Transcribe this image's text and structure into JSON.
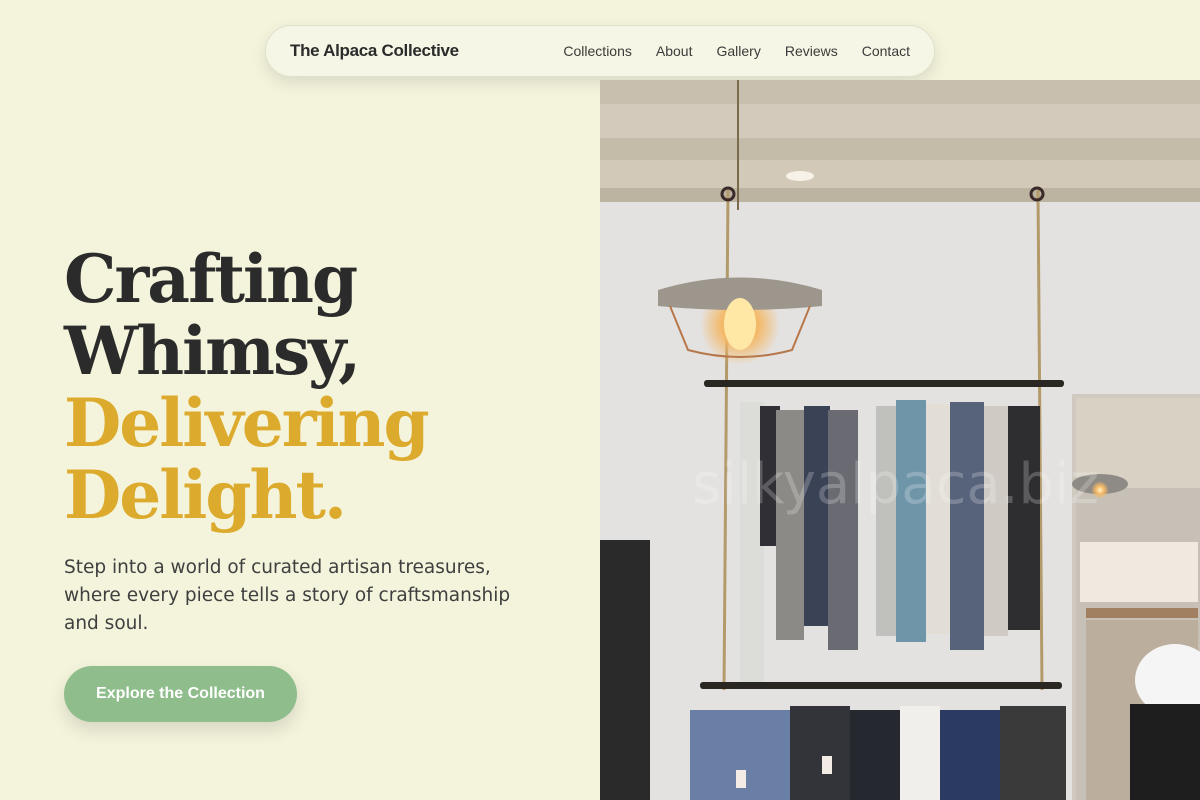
{
  "brand": {
    "name": "The Alpaca Collective"
  },
  "nav": {
    "links": [
      "Collections",
      "About",
      "Gallery",
      "Reviews",
      "Contact"
    ]
  },
  "hero": {
    "headline": [
      "Crafting",
      "Whimsy,",
      "Delivering",
      "Delight."
    ],
    "subtitle": "Step into a world of curated artisan treasures, where every piece tells a story of craftsmanship and soul.",
    "cta_label": "Explore the Collection"
  },
  "image": {
    "watermark": "silkyalpaca.biz"
  },
  "colors": {
    "background": "#f4f4dc",
    "accent": "#dcaa2c",
    "cta": "#8fbd8c",
    "text": "#2b2b2b"
  }
}
